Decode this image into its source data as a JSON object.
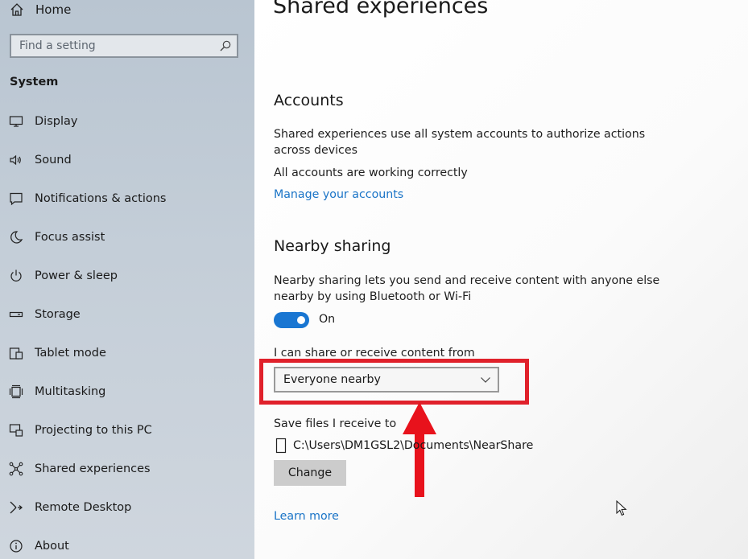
{
  "sidebar": {
    "home_label": "Home",
    "search_placeholder": "Find a setting",
    "section_title": "System",
    "items": [
      {
        "label": "Display",
        "icon": "monitor-icon"
      },
      {
        "label": "Sound",
        "icon": "speaker-icon"
      },
      {
        "label": "Notifications & actions",
        "icon": "notification-icon"
      },
      {
        "label": "Focus assist",
        "icon": "moon-icon"
      },
      {
        "label": "Power & sleep",
        "icon": "power-icon"
      },
      {
        "label": "Storage",
        "icon": "storage-icon"
      },
      {
        "label": "Tablet mode",
        "icon": "tablet-icon"
      },
      {
        "label": "Multitasking",
        "icon": "multitasking-icon"
      },
      {
        "label": "Projecting to this PC",
        "icon": "projecting-icon"
      },
      {
        "label": "Shared experiences",
        "icon": "shared-experiences-icon"
      },
      {
        "label": "Remote Desktop",
        "icon": "remote-desktop-icon"
      },
      {
        "label": "About",
        "icon": "info-icon"
      }
    ]
  },
  "main": {
    "page_title": "Shared experiences",
    "accounts": {
      "heading": "Accounts",
      "description_line1": "Shared experiences use all system accounts to authorize actions",
      "description_line2": "across devices",
      "status": "All accounts are working correctly",
      "manage_link": "Manage your accounts"
    },
    "nearby": {
      "heading": "Nearby sharing",
      "description_line1": "Nearby sharing lets you send and receive content with anyone else",
      "description_line2": "nearby by using Bluetooth or Wi-Fi",
      "toggle_state": "On",
      "share_from_label": "I can share or receive content from",
      "share_from_value": "Everyone nearby",
      "save_label": "Save files I receive to",
      "save_path": "C:\\Users\\DM1GSL2\\Documents\\NearShare",
      "change_button": "Change"
    },
    "learn_more": "Learn more"
  },
  "colors": {
    "accent": "#1976d2",
    "link": "#1a74c7",
    "highlight": "#e0212b",
    "arrow": "#e8121c"
  }
}
